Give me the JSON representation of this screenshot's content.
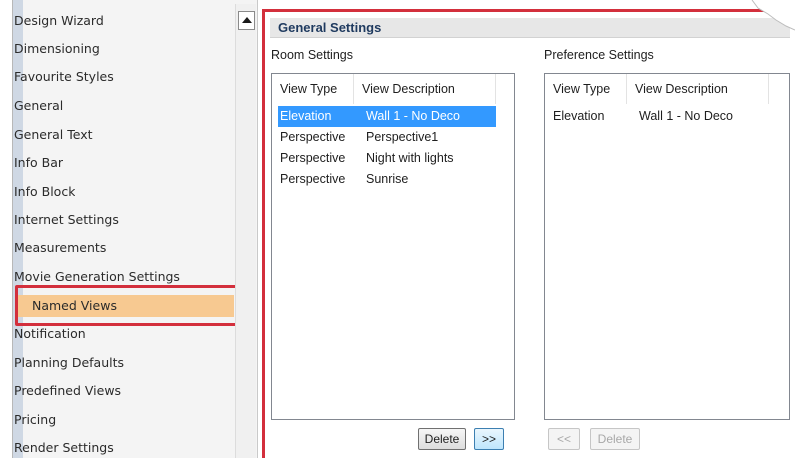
{
  "sidebar": {
    "items": [
      {
        "label": "Design Wizard",
        "selected": false
      },
      {
        "label": "Dimensioning",
        "selected": false
      },
      {
        "label": "Favourite Styles",
        "selected": false
      },
      {
        "label": "General",
        "selected": false
      },
      {
        "label": "General Text",
        "selected": false
      },
      {
        "label": "Info Bar",
        "selected": false
      },
      {
        "label": "Info Block",
        "selected": false
      },
      {
        "label": "Internet Settings",
        "selected": false
      },
      {
        "label": "Measurements",
        "selected": false
      },
      {
        "label": "Movie Generation Settings",
        "selected": false
      },
      {
        "label": "Named Views",
        "selected": true
      },
      {
        "label": "Notification",
        "selected": false
      },
      {
        "label": "Planning Defaults",
        "selected": false
      },
      {
        "label": "Predefined Views",
        "selected": false
      },
      {
        "label": "Pricing",
        "selected": false
      },
      {
        "label": "Render Settings",
        "selected": false
      }
    ]
  },
  "panel": {
    "title": "General Settings",
    "room": {
      "label": "Room Settings",
      "columns": [
        "View Type",
        "View Description"
      ],
      "rows": [
        {
          "type": "Elevation",
          "description": "Wall 1 - No Deco",
          "selected": true
        },
        {
          "type": "Perspective",
          "description": "Perspective1",
          "selected": false
        },
        {
          "type": "Perspective",
          "description": "Night with lights",
          "selected": false
        },
        {
          "type": "Perspective",
          "description": "Sunrise",
          "selected": false
        }
      ],
      "delete_label": "Delete",
      "move_right_label": ">>"
    },
    "preference": {
      "label": "Preference Settings",
      "columns": [
        "View Type",
        "View Description"
      ],
      "rows": [
        {
          "type": "Elevation",
          "description": "Wall 1 - No Deco",
          "selected": false
        }
      ],
      "move_left_label": "<<",
      "delete_label": "Delete"
    }
  },
  "colors": {
    "accent_highlight": "#d32f3c",
    "selected_item": "#f7c991",
    "selected_row": "#3399ff"
  }
}
